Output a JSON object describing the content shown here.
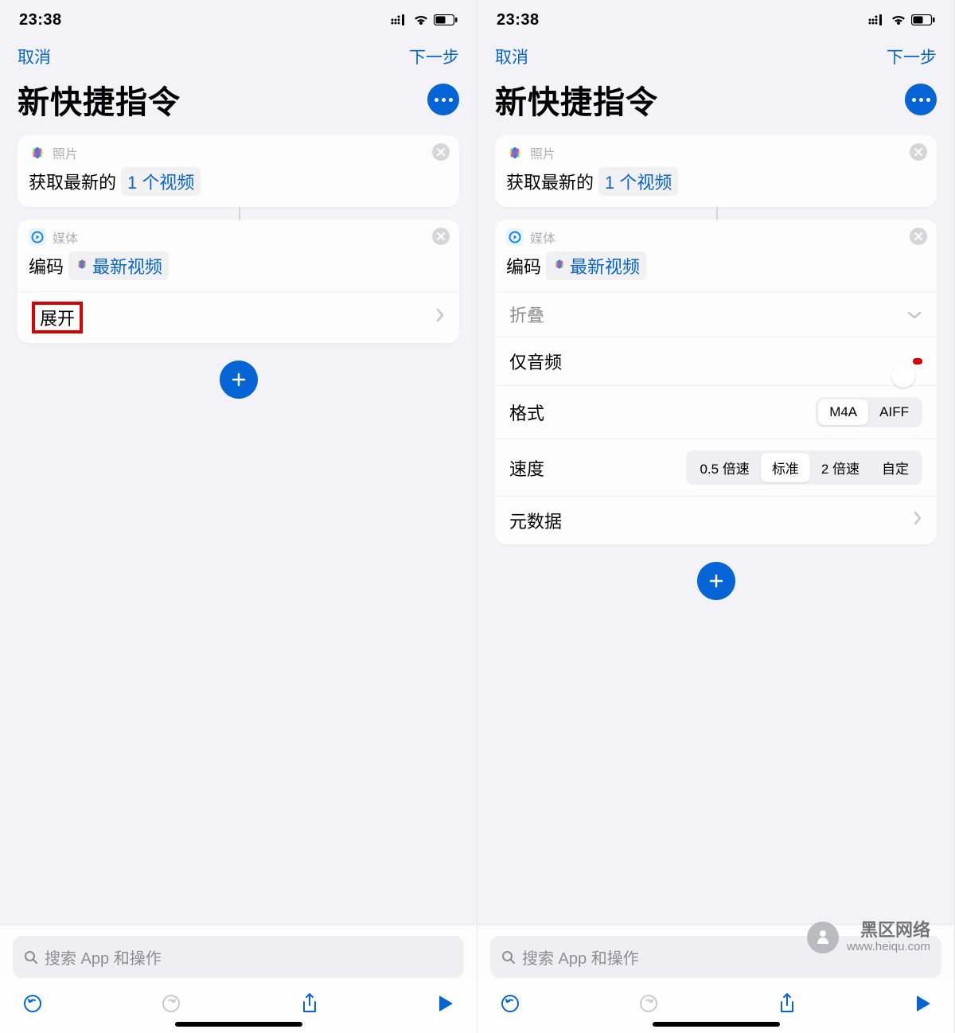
{
  "status": {
    "time": "23:38"
  },
  "nav": {
    "cancel": "取消",
    "next": "下一步"
  },
  "title": "新快捷指令",
  "photos": {
    "app": "照片",
    "prefix": "获取最新的",
    "token": "1 个视频"
  },
  "media": {
    "app": "媒体",
    "prefix": "编码",
    "token": "最新视频"
  },
  "left": {
    "expand": "展开"
  },
  "right": {
    "collapse": "折叠",
    "audioOnly": "仅音频",
    "format": "格式",
    "formats": {
      "m4a": "M4A",
      "aiff": "AIFF"
    },
    "speed": "速度",
    "speeds": {
      "half": "0.5 倍速",
      "normal": "标准",
      "double": "2 倍速",
      "custom": "自定"
    },
    "metadata": "元数据"
  },
  "search": {
    "placeholder": "搜索 App 和操作"
  },
  "watermark": {
    "title": "黑区网络",
    "sub": "www.heiqu.com"
  }
}
